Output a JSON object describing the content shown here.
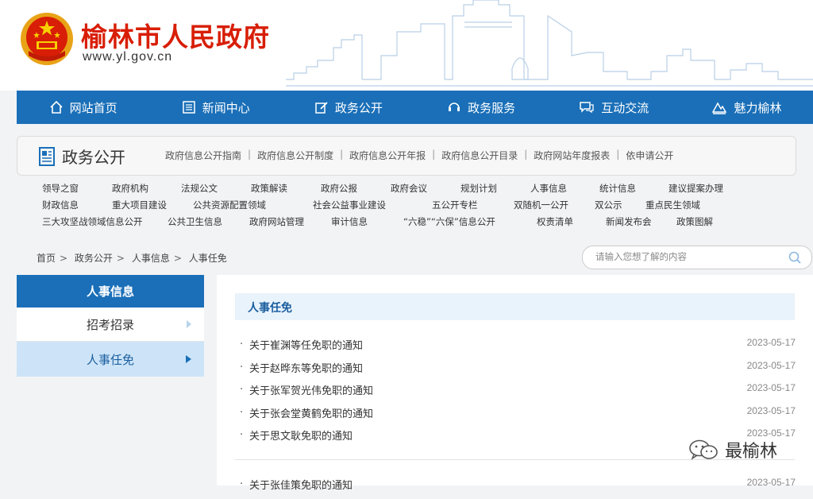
{
  "header": {
    "site_title": "榆林市人民政府",
    "site_domain": "www.yl.gov.cn",
    "brand_color": "#d81e06"
  },
  "nav": {
    "color": "#1a6fb8",
    "items": [
      {
        "label": "网站首页",
        "icon": "home-icon"
      },
      {
        "label": "新闻中心",
        "icon": "news-icon"
      },
      {
        "label": "政务公开",
        "icon": "edit-icon"
      },
      {
        "label": "政务服务",
        "icon": "service-icon"
      },
      {
        "label": "互动交流",
        "icon": "chat-icon"
      },
      {
        "label": "魅力榆林",
        "icon": "landscape-icon"
      }
    ]
  },
  "info": {
    "title": "政务公开",
    "links": [
      "政府信息公开指南",
      "政府信息公开制度",
      "政府信息公开年报",
      "政府信息公开目录",
      "政府网站年度报表",
      "依申请公开"
    ]
  },
  "categories": {
    "row1": [
      "领导之窗",
      "政府机构",
      "法规公文",
      "政策解读",
      "政府公报",
      "政府会议",
      "规划计划",
      "人事信息",
      "统计信息",
      "建议提案办理"
    ],
    "row2": [
      "财政信息",
      "重大项目建设",
      "公共资源配置领域",
      "社会公益事业建设",
      "五公开专栏",
      "双随机一公开",
      "双公示",
      "重点民生领域"
    ],
    "row3": [
      "三大攻坚战领域信息公开",
      "公共卫生信息",
      "政府网站管理",
      "审计信息",
      "“六稳”“六保”信息公开",
      "权责清单",
      "新闻发布会",
      "政策图解"
    ]
  },
  "breadcrumb": [
    "首页",
    "政务公开",
    "人事信息",
    "人事任免"
  ],
  "search": {
    "placeholder": "请输入您想了解的内容"
  },
  "sidebar": {
    "title": "人事信息",
    "items": [
      {
        "label": "招考招录",
        "active": false
      },
      {
        "label": "人事任免",
        "active": true
      }
    ]
  },
  "content": {
    "title": "人事任免",
    "items": [
      {
        "title": "关于崔渊等任免职的通知",
        "date": "2023-05-17"
      },
      {
        "title": "关于赵晔东等免职的通知",
        "date": "2023-05-17"
      },
      {
        "title": "关于张军贺光伟免职的通知",
        "date": "2023-05-17"
      },
      {
        "title": "关于张会堂黄鹤免职的通知",
        "date": "2023-05-17"
      },
      {
        "title": "关于思文耿免职的通知",
        "date": "2023-05-17"
      }
    ],
    "cut_item": {
      "title": "关于张佳策免职的通知",
      "date": "2023-05-17"
    }
  },
  "watermark": {
    "text": "最榆林"
  }
}
